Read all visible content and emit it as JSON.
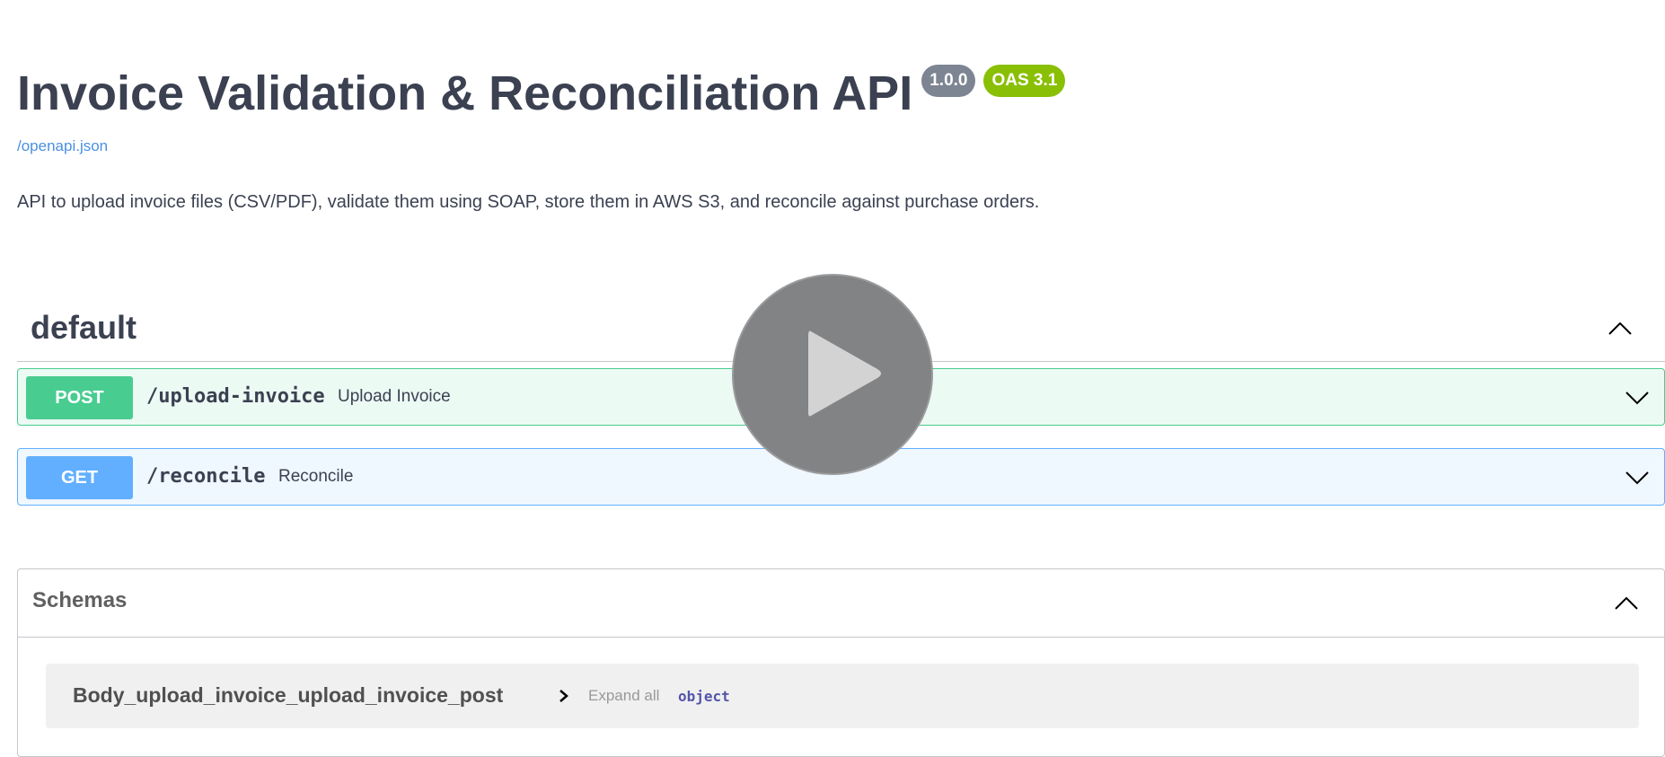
{
  "info": {
    "title": "Invoice Validation & Reconciliation API",
    "version_badge": "1.0.0",
    "oas_badge": "OAS 3.1",
    "spec_link": "/openapi.json",
    "description": "API to upload invoice files (CSV/PDF), validate them using SOAP, store them in AWS S3, and reconcile against purchase orders."
  },
  "tag": {
    "name": "default",
    "toggle_icon": "chevron-up-icon"
  },
  "operations": [
    {
      "method": "POST",
      "path": "/upload-invoice",
      "summary": "Upload Invoice",
      "color": "#49cc90",
      "toggle_icon": "chevron-down-icon"
    },
    {
      "method": "GET",
      "path": "/reconcile",
      "summary": "Reconcile",
      "color": "#61affe",
      "toggle_icon": "chevron-down-icon"
    }
  ],
  "schemas": {
    "title": "Schemas",
    "toggle_icon": "chevron-up-icon",
    "models": [
      {
        "name": "Body_upload_invoice_upload_invoice_post",
        "expand_label": "Expand all",
        "type": "object"
      }
    ]
  },
  "overlay": {
    "icon": "play-icon"
  },
  "colors": {
    "text": "#3b4151",
    "link": "#4990e2",
    "version_badge": "#7d8492",
    "oas_badge": "#89bf04"
  }
}
